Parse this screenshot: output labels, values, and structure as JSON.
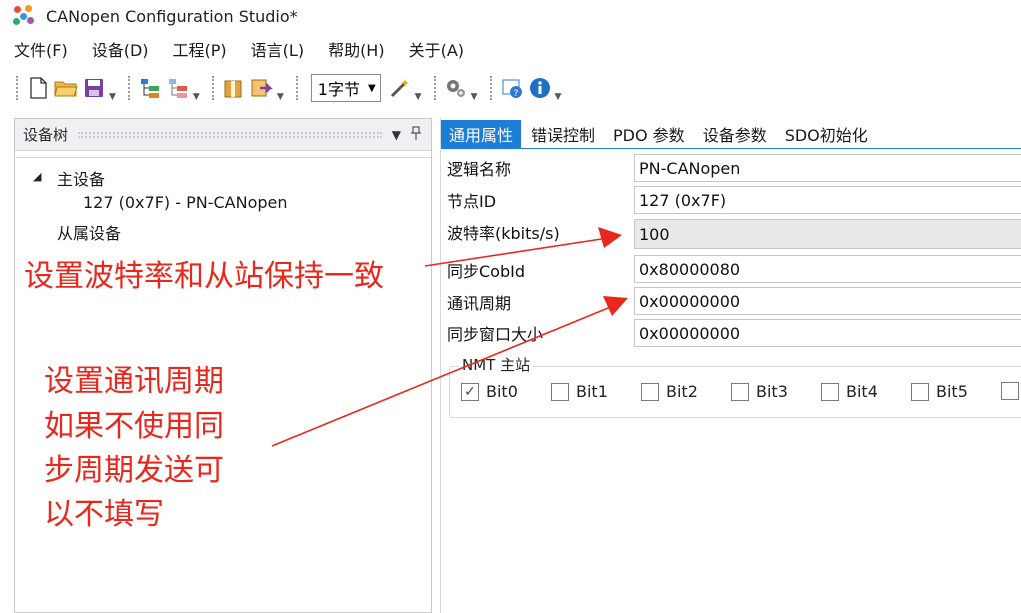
{
  "window": {
    "title": "CANopen Configuration Studio*"
  },
  "menu": [
    "文件(F)",
    "设备(D)",
    "工程(P)",
    "语言(L)",
    "帮助(H)",
    "关于(A)"
  ],
  "toolbar": {
    "icons": [
      "new-file-icon",
      "open-folder-icon",
      "save-icon",
      "add-device-icon",
      "remove-device-icon",
      "export-icon",
      "import-icon",
      "magic-wand-icon",
      "settings-icon",
      "help-icon",
      "info-icon"
    ],
    "unit_select": "1字节"
  },
  "device_tree": {
    "title": "设备树",
    "master_label": "主设备",
    "master_node": "127 (0x7F)  -  PN-CANopen",
    "slave_label": "从属设备"
  },
  "tabs": [
    "通用属性",
    "错误控制",
    "PDO 参数",
    "设备参数",
    "SDO初始化"
  ],
  "active_tab": "通用属性",
  "properties": {
    "logical_name": {
      "label": "逻辑名称",
      "value": "PN-CANopen"
    },
    "node_id": {
      "label": "节点ID",
      "value": "127 (0x7F)"
    },
    "baud_rate": {
      "label": "波特率(kbits/s)",
      "value": "100"
    },
    "sync_cobid": {
      "label": "同步CobId",
      "value": "0x80000080"
    },
    "comm_period": {
      "label": "通讯周期",
      "value": "0x00000000"
    },
    "sync_window": {
      "label": "同步窗口大小",
      "value": "0x00000000"
    }
  },
  "nmt": {
    "title": "NMT 主站",
    "bits": [
      "Bit0",
      "Bit1",
      "Bit2",
      "Bit3",
      "Bit4",
      "Bit5"
    ],
    "checked": [
      true,
      false,
      false,
      false,
      false,
      false
    ]
  },
  "annotations": {
    "baud_note": "设置波特率和从站保持一致",
    "period_note": [
      "设置通讯周期",
      "如果不使用同",
      "步周期发送可",
      "以不填写"
    ]
  },
  "colors": {
    "accent": "#1c7ed6",
    "annotation": "#e8281c"
  }
}
